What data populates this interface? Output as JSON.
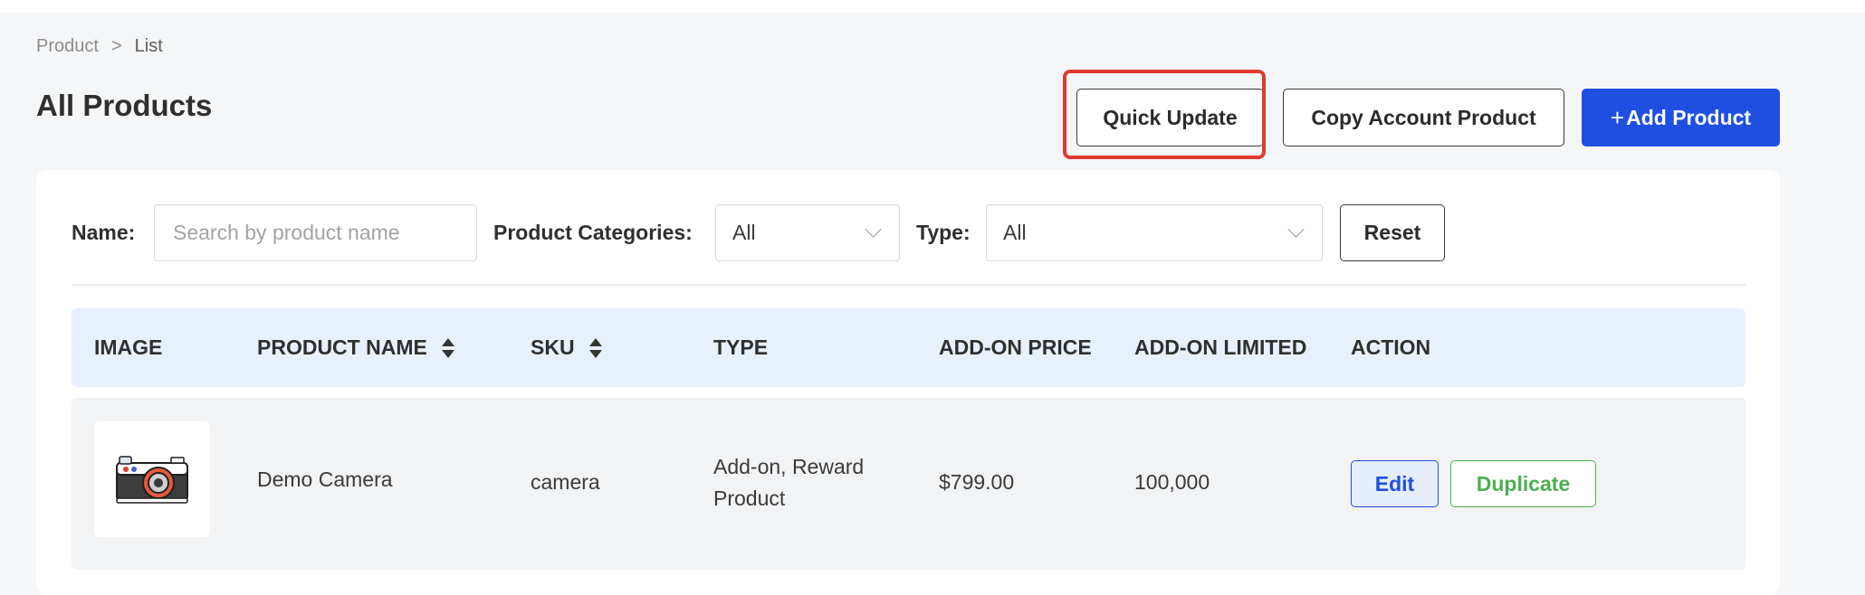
{
  "breadcrumb": {
    "parent": "Product",
    "separator": ">",
    "current": "List"
  },
  "page_title": "All Products",
  "toolbar": {
    "quick_update": "Quick Update",
    "copy_account_product": "Copy Account Product",
    "add_product_icon": "+",
    "add_product": "Add Product"
  },
  "filters": {
    "name_label": "Name:",
    "name_placeholder": "Search by product name",
    "categories_label": "Product Categories:",
    "categories_value": "All",
    "type_label": "Type:",
    "type_value": "All",
    "reset": "Reset"
  },
  "table": {
    "columns": [
      "IMAGE",
      "PRODUCT NAME",
      "SKU",
      "TYPE",
      "ADD-ON PRICE",
      "ADD-ON LIMITED",
      "ACTION"
    ],
    "rows": [
      {
        "image_icon": "camera-icon",
        "product_name": "Demo Camera",
        "sku": "camera",
        "type_line1": "Add-on, Reward",
        "type_line2": "Product",
        "addon_price": "$799.00",
        "addon_limited": "100,000",
        "edit": "Edit",
        "duplicate": "Duplicate"
      }
    ]
  },
  "colors": {
    "primary": "#1f4fe0",
    "highlight": "#e03a2f",
    "success": "#4caf50",
    "table_header_bg": "#e8f0fc"
  }
}
